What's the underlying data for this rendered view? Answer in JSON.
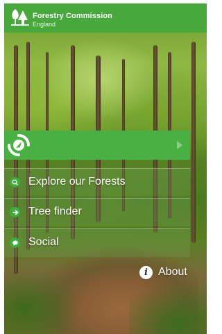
{
  "header": {
    "title": "Forestry Commission",
    "subtitle": "England",
    "logo_icon": "tree-logo-icon"
  },
  "banner": {
    "icon": "location-arrow-icon",
    "arrow_icon": "play-arrow-icon"
  },
  "menu": {
    "items": [
      {
        "label": "Explore our Forests",
        "icon": "search-icon"
      },
      {
        "label": "Tree finder",
        "icon": "arrow-right-icon"
      },
      {
        "label": "Social",
        "icon": "speech-bubble-icon"
      }
    ]
  },
  "about": {
    "label": "About",
    "icon": "info-icon"
  },
  "colors": {
    "brand_green": "#47a83c",
    "banner_green": "#49b043"
  }
}
